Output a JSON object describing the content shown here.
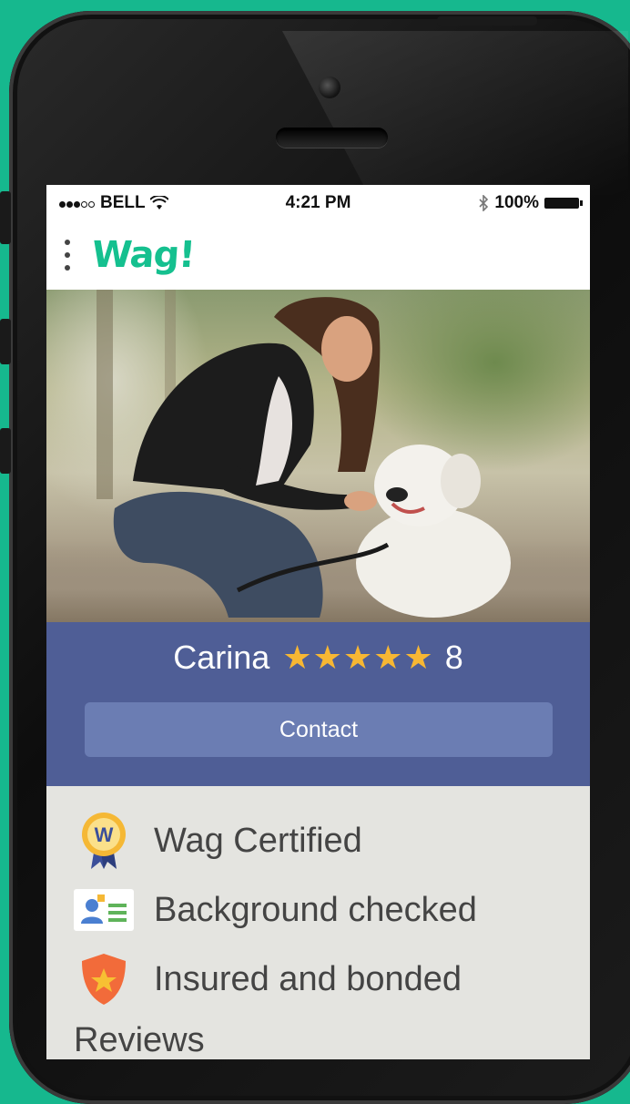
{
  "status_bar": {
    "carrier": "BELL",
    "time": "4:21 PM",
    "battery": "100%",
    "icons": [
      "signal-dots-icon",
      "wifi-icon",
      "bluetooth-icon",
      "battery-icon"
    ]
  },
  "app": {
    "logo": "Wag!",
    "menu_icon": "kebab-menu-icon",
    "brand_color": "#15c08f"
  },
  "walker": {
    "name": "Carina",
    "stars": "★★★★★",
    "rating_count": "8",
    "contact_label": "Contact"
  },
  "badges": [
    {
      "icon": "wag-certified-ribbon-icon",
      "label": "Wag Certified"
    },
    {
      "icon": "background-check-id-icon",
      "label": "Background checked"
    },
    {
      "icon": "shield-star-icon",
      "label": "Insured and bonded"
    }
  ],
  "reviews_label": "Reviews",
  "colors": {
    "background": "#16b88e",
    "profile_band": "#4f5e96",
    "contact_button": "#6b7db3",
    "star": "#f7b733"
  }
}
